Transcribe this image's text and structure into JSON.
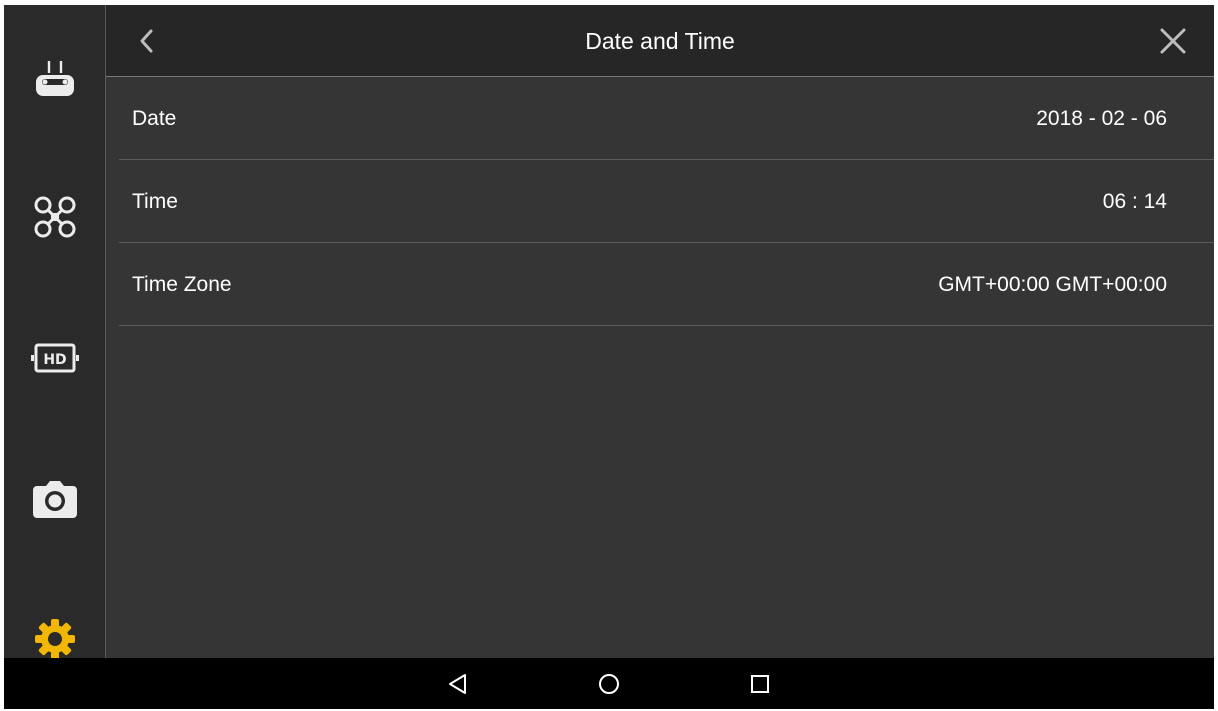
{
  "header": {
    "title": "Date and Time",
    "back_icon": "chevron-left-icon",
    "close_icon": "close-icon"
  },
  "sidebar": {
    "items": [
      {
        "name": "remote-controller",
        "icon": "remote-controller-icon",
        "active": false
      },
      {
        "name": "aircraft",
        "icon": "drone-icon",
        "active": false
      },
      {
        "name": "hd-transmission",
        "icon": "hd-icon",
        "active": false
      },
      {
        "name": "camera",
        "icon": "camera-icon",
        "active": false
      },
      {
        "name": "general-settings",
        "icon": "gear-icon",
        "active": true
      }
    ]
  },
  "settings": {
    "rows": [
      {
        "label": "Date",
        "value": "2018 - 02 - 06"
      },
      {
        "label": "Time",
        "value": "06 : 14"
      },
      {
        "label": "Time Zone",
        "value": "GMT+00:00 GMT+00:00"
      }
    ]
  },
  "navbar": {
    "buttons": [
      {
        "name": "back",
        "icon": "triangle-back-icon"
      },
      {
        "name": "home",
        "icon": "circle-home-icon"
      },
      {
        "name": "recents",
        "icon": "square-recents-icon"
      }
    ]
  },
  "colors": {
    "background": "#353535",
    "sidebar": "#2a2a2a",
    "header": "#262626",
    "active_accent": "#f2b705",
    "text": "#ffffff",
    "icon": "#e8e8e8"
  }
}
